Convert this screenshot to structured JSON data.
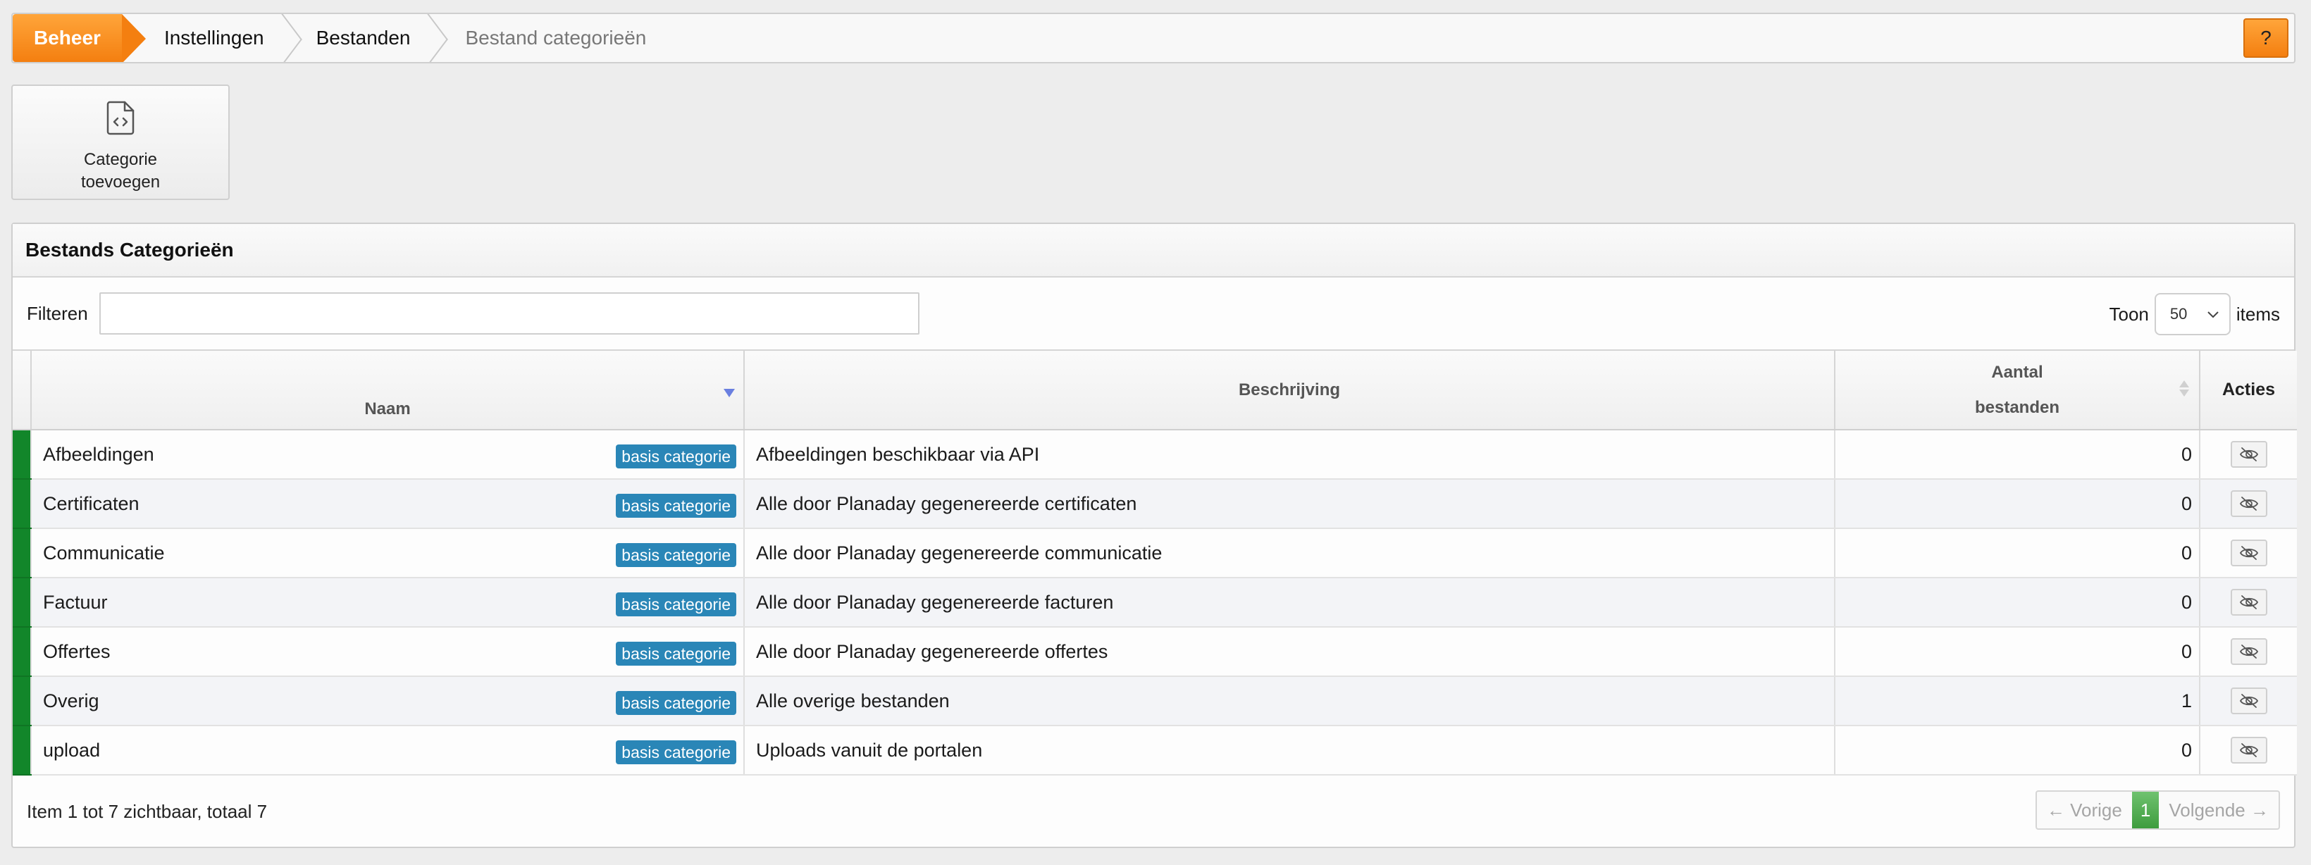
{
  "breadcrumb": {
    "items": [
      "Beheer",
      "Instellingen",
      "Bestanden",
      "Bestand categorieën"
    ],
    "help_label": "?"
  },
  "toolbar": {
    "add_category_label": "Categorie toevoegen"
  },
  "panel": {
    "title": "Bestands Categorieën",
    "filter_label": "Filteren",
    "filter_value": "",
    "show_label": "Toon",
    "page_size": "50",
    "items_label": "items"
  },
  "table": {
    "columns": {
      "name": "Naam",
      "description": "Beschrijving",
      "count_line1": "Aantal",
      "count_line2": "bestanden",
      "actions": "Acties"
    },
    "rows": [
      {
        "name": "Afbeeldingen",
        "badge": "basis categorie",
        "description": "Afbeeldingen beschikbaar via API",
        "count": "0"
      },
      {
        "name": "Certificaten",
        "badge": "basis categorie",
        "description": "Alle door Planaday gegenereerde certificaten",
        "count": "0"
      },
      {
        "name": "Communicatie",
        "badge": "basis categorie",
        "description": "Alle door Planaday gegenereerde communicatie",
        "count": "0"
      },
      {
        "name": "Factuur",
        "badge": "basis categorie",
        "description": "Alle door Planaday gegenereerde facturen",
        "count": "0"
      },
      {
        "name": "Offertes",
        "badge": "basis categorie",
        "description": "Alle door Planaday gegenereerde offertes",
        "count": "0"
      },
      {
        "name": "Overig",
        "badge": "basis categorie",
        "description": "Alle overige bestanden",
        "count": "1"
      },
      {
        "name": "upload",
        "badge": "basis categorie",
        "description": "Uploads vanuit de portalen",
        "count": "0"
      }
    ],
    "row_status_color": "#12862a",
    "action_icon": "eye-slash-icon"
  },
  "footer": {
    "summary": "Item 1 tot 7 zichtbaar, totaal 7",
    "prev_label": "← Vorige",
    "current_page": "1",
    "next_label": "Volgende →"
  },
  "colors": {
    "accent_orange": "#f47f10",
    "badge_blue": "#2a86b7",
    "pager_green": "#3e9c3e"
  }
}
